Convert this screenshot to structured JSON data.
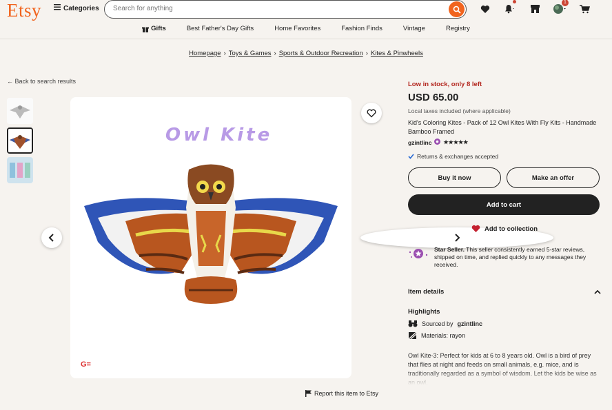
{
  "header": {
    "logo": "Etsy",
    "categories_label": "Categories",
    "search_placeholder": "Search for anything",
    "cart_badge": "1",
    "colors": {
      "accent": "#f1641e",
      "dark": "#222222",
      "alert": "#b3261e"
    }
  },
  "nav": [
    "Gifts",
    "Best Father's Day Gifts",
    "Home Favorites",
    "Fashion Finds",
    "Vintage",
    "Registry"
  ],
  "breadcrumb": [
    "Homepage",
    "Toys & Games",
    "Sports & Outdoor Recreation",
    "Kites & Pinwheels"
  ],
  "back_link": "Back to search results",
  "image": {
    "text": "Owl Kite",
    "brand_mark": "G="
  },
  "report_link": "Report this item to Etsy",
  "product": {
    "stock_notice": "Low in stock, only 8 left",
    "price": "USD 65.00",
    "tax_note": "Local taxes included (where applicable)",
    "title": "Kid's Coloring Kites - Pack of 12 Owl Kites With Fly Kits - Handmade Bamboo Framed",
    "seller": "gzintlinc",
    "rating_stars": "★★★★★",
    "returns": "Returns & exchanges accepted",
    "buy_now": "Buy it now",
    "make_offer": "Make an offer",
    "add_to_cart": "Add to cart",
    "add_to_collection": "Add to collection",
    "star_seller_title": "Star Seller.",
    "star_seller_text": "This seller consistently earned 5-star reviews, shipped on time, and replied quickly to any messages they received.",
    "item_details": "Item details",
    "highlights": "Highlights",
    "sourced_by_label": "Sourced by",
    "sourced_by_seller": "gzintlinc",
    "materials": "Materials: rayon",
    "description": "Owl Kite-3: Perfect for kids at 6 to 8 years old. Owl is a bird of prey that flies at night and feeds on small animals, e.g. mice, and is traditionally regarded as a symbol of wisdom. Let the kids be wise as an owl."
  }
}
